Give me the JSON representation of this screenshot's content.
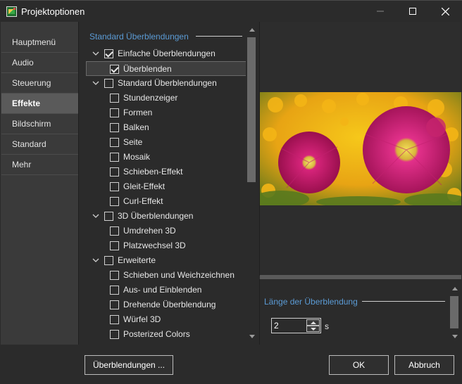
{
  "window": {
    "title": "Projektoptionen"
  },
  "sidebar": {
    "items": [
      {
        "label": "Hauptmenü",
        "active": false
      },
      {
        "label": "Audio",
        "active": false
      },
      {
        "label": "Steuerung",
        "active": false
      },
      {
        "label": "Effekte",
        "active": true
      },
      {
        "label": "Bildschirm",
        "active": false
      },
      {
        "label": "Standard",
        "active": false
      },
      {
        "label": "Mehr",
        "active": false
      }
    ]
  },
  "transitions": {
    "header": "Standard Überblendungen",
    "rows": [
      {
        "label": "Einfache Überblendungen",
        "checked": true,
        "group": true
      },
      {
        "label": "Überblenden",
        "checked": true,
        "group": false,
        "selected": true
      },
      {
        "label": "Standard Überblendungen",
        "checked": false,
        "group": true
      },
      {
        "label": "Stundenzeiger",
        "checked": false,
        "group": false
      },
      {
        "label": "Formen",
        "checked": false,
        "group": false
      },
      {
        "label": "Balken",
        "checked": false,
        "group": false
      },
      {
        "label": "Seite",
        "checked": false,
        "group": false
      },
      {
        "label": "Mosaik",
        "checked": false,
        "group": false
      },
      {
        "label": "Schieben-Effekt",
        "checked": false,
        "group": false
      },
      {
        "label": "Gleit-Effekt",
        "checked": false,
        "group": false
      },
      {
        "label": "Curl-Effekt",
        "checked": false,
        "group": false
      },
      {
        "label": "3D Überblendungen",
        "checked": false,
        "group": true
      },
      {
        "label": "Umdrehen 3D",
        "checked": false,
        "group": false
      },
      {
        "label": "Platzwechsel 3D",
        "checked": false,
        "group": false
      },
      {
        "label": "Erweiterte",
        "checked": false,
        "group": true
      },
      {
        "label": "Schieben und Weichzeichnen",
        "checked": false,
        "group": false
      },
      {
        "label": "Aus- und Einblenden",
        "checked": false,
        "group": false
      },
      {
        "label": "Drehende Überblendung",
        "checked": false,
        "group": false
      },
      {
        "label": "Würfel 3D",
        "checked": false,
        "group": false
      },
      {
        "label": "Posterized Colors",
        "checked": false,
        "group": false
      }
    ]
  },
  "length": {
    "header": "Länge der Überblendung",
    "value": "2",
    "unit": "s"
  },
  "footer": {
    "transitions_label": "Überblendungen ...",
    "ok_label": "OK",
    "cancel_label": "Abbruch"
  },
  "colors": {
    "accent": "#5b9bd5",
    "background": "#2b2b2b",
    "sidebar": "#3a3a3a",
    "sidebar_active": "#5a5a5a"
  }
}
